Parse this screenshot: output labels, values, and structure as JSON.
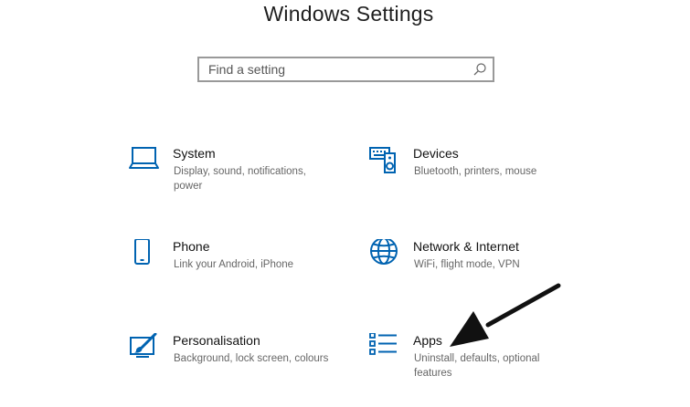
{
  "header": {
    "title": "Windows Settings"
  },
  "search": {
    "placeholder": "Find a setting",
    "value": ""
  },
  "tiles": [
    {
      "name": "System",
      "description": "Display, sound, notifications, power",
      "icon": "laptop-icon"
    },
    {
      "name": "Devices",
      "description": "Bluetooth, printers, mouse",
      "icon": "devices-icon"
    },
    {
      "name": "Phone",
      "description": "Link your Android, iPhone",
      "icon": "phone-icon"
    },
    {
      "name": "Network & Internet",
      "description": "WiFi, flight mode, VPN",
      "icon": "globe-icon"
    },
    {
      "name": "Personalisation",
      "description": "Background, lock screen, colours",
      "icon": "paint-brush-icon"
    },
    {
      "name": "Apps",
      "description": "Uninstall, defaults, optional features",
      "icon": "apps-list-icon"
    }
  ],
  "colors": {
    "accent": "#0063b1",
    "annotation_arrow": "#111111"
  }
}
